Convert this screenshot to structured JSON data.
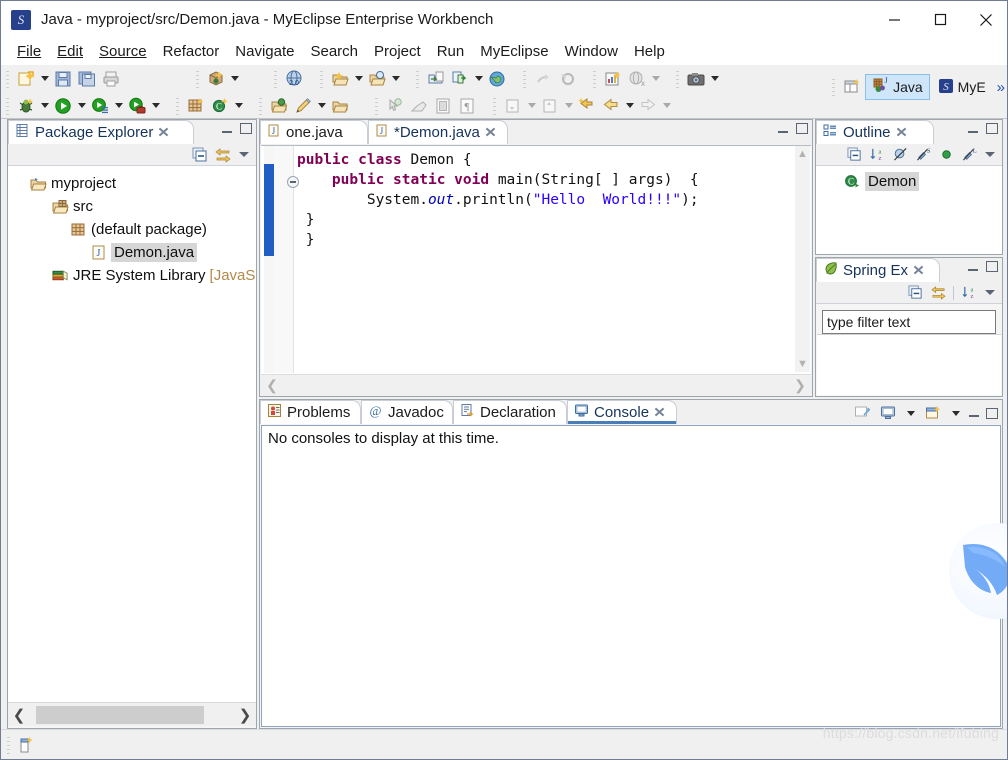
{
  "window": {
    "title": "Java - myproject/src/Demon.java - MyEclipse Enterprise Workbench",
    "app_icon": "myeclipse-icon",
    "controls": {
      "minimize": "minimize-icon",
      "maximize": "maximize-icon",
      "close": "close-icon"
    }
  },
  "menubar": {
    "items": [
      {
        "label": "File",
        "mnemonic": "F"
      },
      {
        "label": "Edit",
        "mnemonic": "E"
      },
      {
        "label": "Source",
        "mnemonic": "S"
      },
      {
        "label": "Refactor",
        "mnemonic": "t"
      },
      {
        "label": "Navigate",
        "mnemonic": "N"
      },
      {
        "label": "Search",
        "mnemonic": "a"
      },
      {
        "label": "Project",
        "mnemonic": "P"
      },
      {
        "label": "Run",
        "mnemonic": "R"
      },
      {
        "label": "MyEclipse",
        "mnemonic": ""
      },
      {
        "label": "Window",
        "mnemonic": "W"
      },
      {
        "label": "Help",
        "mnemonic": "H"
      }
    ]
  },
  "perspective": {
    "open_perspective_icon": "open-perspective-icon",
    "items": [
      {
        "label": "Java",
        "icon": "java-perspective-icon",
        "active": true
      },
      {
        "label": "MyE",
        "icon": "myeclipse-perspective-icon",
        "active": false
      }
    ],
    "overflow": "»"
  },
  "package_explorer": {
    "title": "Package Explorer",
    "icon": "package-explorer-icon",
    "close_icon": "close-icon",
    "toolbar": [
      "collapse-all-icon",
      "link-with-editor-icon",
      "view-menu-icon"
    ],
    "minimize_icon": "minimize-icon",
    "maximize_icon": "maximize-icon",
    "tree": [
      {
        "label": "myproject",
        "icon": "project-folder-icon",
        "indent": 0,
        "selected": false,
        "suffix": ""
      },
      {
        "label": "src",
        "icon": "source-folder-icon",
        "indent": 1,
        "selected": false,
        "suffix": ""
      },
      {
        "label": "(default package)",
        "icon": "package-icon",
        "indent": 2,
        "selected": false,
        "suffix": ""
      },
      {
        "label": "Demon.java",
        "icon": "java-file-icon",
        "indent": 3,
        "selected": true,
        "suffix": ""
      },
      {
        "label": "JRE System Library",
        "icon": "library-icon",
        "indent": 1,
        "selected": false,
        "suffix": "[JavaS"
      }
    ],
    "scroll": {
      "left_arrow": "scroll-left-icon",
      "right_arrow": "scroll-right-icon"
    }
  },
  "editor": {
    "tabs": [
      {
        "label": "one.java",
        "icon": "java-file-icon",
        "dirty": false,
        "active": false,
        "closable": false
      },
      {
        "label": "*Demon.java",
        "icon": "java-file-icon",
        "dirty": true,
        "active": true,
        "closable": true
      }
    ],
    "minimize_icon": "minimize-icon",
    "maximize_icon": "maximize-icon",
    "code_lines": [
      {
        "text": "public class Demon {",
        "indent": 0
      },
      {
        "text": "    public static void main(String[ ] args)  {",
        "indent": 0
      },
      {
        "text": "        System.out.println(\"Hello  World!!!\");",
        "indent": 0
      },
      {
        "text": " }",
        "indent": 0
      },
      {
        "text": " }",
        "indent": 0
      }
    ],
    "code_plain": "public class Demon {\n    public static void main(String[ ] args)  {\n        System.out.println(\"Hello  World!!!\");\n }\n }",
    "syntax_colors": {
      "keyword": "#7f0055",
      "string": "#2a00ff",
      "field": "#0000c0",
      "plain": "#111111"
    },
    "caret_line_color": "#e8f0fe",
    "change_stripe_color": "#1f5ec4"
  },
  "outline": {
    "title": "Outline",
    "icon": "outline-icon",
    "close_icon": "close-icon",
    "toolbar": [
      "collapse-all-icon",
      "sort-icon",
      "hide-fields-icon",
      "hide-static-icon",
      "hide-nonpublic-icon",
      "hide-local-types-icon",
      "view-menu-icon"
    ],
    "items": [
      {
        "label": "Demon",
        "icon": "class-icon",
        "selected": true
      }
    ]
  },
  "spring_explorer": {
    "title": "Spring Ex",
    "icon": "spring-leaf-icon",
    "close_icon": "close-icon",
    "toolbar": [
      "collapse-all-icon",
      "link-with-editor-icon",
      "sort-icon",
      "view-menu-icon"
    ],
    "filter": {
      "value": "type filter text",
      "placeholder": "type filter text"
    },
    "items": []
  },
  "console_panel": {
    "tabs": [
      {
        "label": "Problems",
        "icon": "problems-icon",
        "active": false,
        "closable": false
      },
      {
        "label": "Javadoc",
        "icon": "javadoc-icon",
        "active": false,
        "closable": false
      },
      {
        "label": "Declaration",
        "icon": "declaration-icon",
        "active": false,
        "closable": false
      },
      {
        "label": "Console",
        "icon": "console-icon",
        "active": true,
        "closable": true
      }
    ],
    "toolbar": [
      "clear-console-icon",
      "display-selected-console-icon",
      "display-selected-console-menu-icon",
      "open-console-icon",
      "open-console-menu-icon"
    ],
    "minimize_icon": "minimize-icon",
    "maximize_icon": "maximize-icon",
    "message": "No consoles to display at this time."
  },
  "statusbar": {
    "icon": "new-element-icon",
    "text": ""
  },
  "watermark": {
    "text": "https://blog.csdn.net/ifubing",
    "logo": "bird-logo"
  },
  "colors": {
    "accent": "#4a7db5",
    "selection": "#cfe6fa",
    "panel_bg": "#f0f0f0",
    "tab_text": "#16335c"
  }
}
